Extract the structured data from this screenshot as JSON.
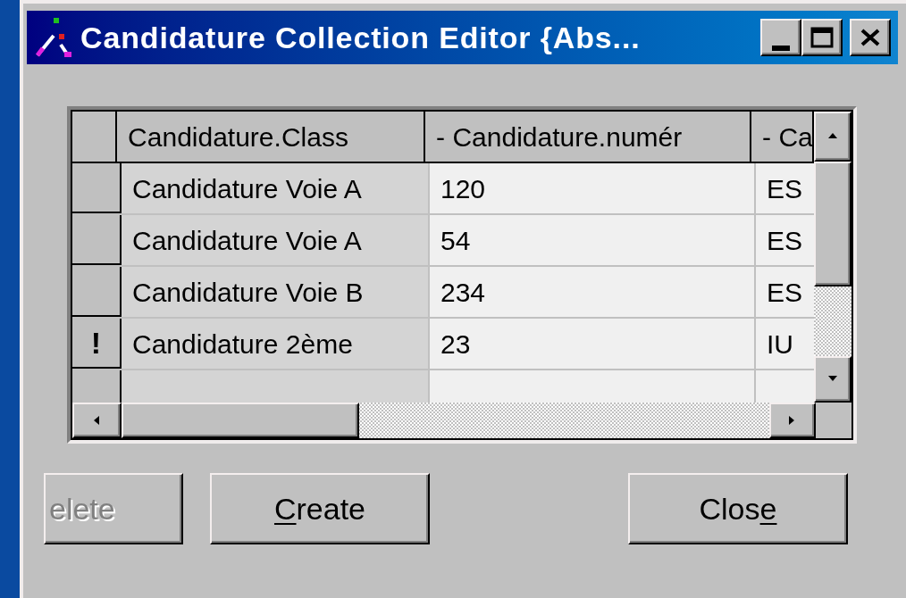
{
  "window": {
    "title": "Candidature Collection Editor {Abs..."
  },
  "table": {
    "columns": [
      "Candidature.Class",
      "- Candidature.numér",
      "- Ca"
    ],
    "rows": [
      {
        "indicator": "",
        "cells": [
          "Candidature Voie A",
          "120",
          "ES"
        ]
      },
      {
        "indicator": "",
        "cells": [
          "Candidature Voie A",
          "54",
          "ES"
        ]
      },
      {
        "indicator": "",
        "cells": [
          "Candidature Voie B",
          "234",
          "ES"
        ]
      },
      {
        "indicator": "!",
        "cells": [
          "Candidature 2ème",
          "23",
          "IU"
        ]
      }
    ]
  },
  "buttons": [
    {
      "before": "elete",
      "disabled": true
    },
    {
      "hotkey": "C",
      "after": "reate",
      "disabled": false
    },
    {
      "before": "Clos",
      "hotkey": "e",
      "disabled": false
    }
  ]
}
